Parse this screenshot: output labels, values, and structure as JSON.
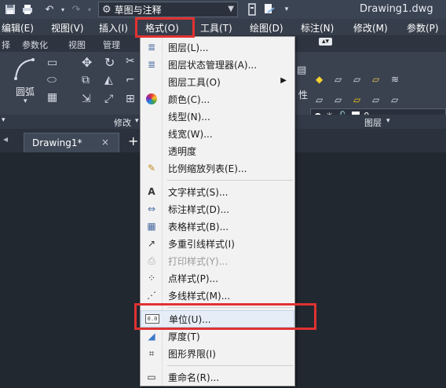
{
  "window": {
    "title": "Drawing1.dwg",
    "workspace": "草图与注释"
  },
  "menubar": {
    "items": [
      "编辑(E)",
      "视图(V)",
      "插入(I)",
      "格式(O)",
      "工具(T)",
      "绘图(D)",
      "标注(N)",
      "修改(M)",
      "参数(P)"
    ]
  },
  "ribbon": {
    "tabs": [
      "择",
      "参数化",
      "视图",
      "管理"
    ],
    "arc_label": "圆弧",
    "modify_label": "修改",
    "layers_label": "图层",
    "layer_current": "0",
    "attr_fragment": "性"
  },
  "doc_tabs": {
    "active": "Drawing1*",
    "close": "×",
    "new": "+"
  },
  "format_menu": {
    "items": [
      {
        "label": "图层(L)...",
        "icon": "layer-icon"
      },
      {
        "label": "图层状态管理器(A)...",
        "icon": "layer-state-icon"
      },
      {
        "label": "图层工具(O)",
        "icon": "none",
        "submenu": true
      },
      {
        "label": "颜色(C)...",
        "icon": "color-wheel-icon"
      },
      {
        "label": "线型(N)...",
        "icon": "none"
      },
      {
        "label": "线宽(W)...",
        "icon": "none"
      },
      {
        "label": "透明度",
        "icon": "none"
      },
      {
        "label": "比例缩放列表(E)...",
        "icon": "scale-list-icon"
      },
      {
        "label": "文字样式(S)...",
        "icon": "text-style-icon"
      },
      {
        "label": "标注样式(D)...",
        "icon": "dim-style-icon"
      },
      {
        "label": "表格样式(B)...",
        "icon": "table-style-icon"
      },
      {
        "label": "多重引线样式(I)",
        "icon": "mleader-style-icon"
      },
      {
        "label": "打印样式(Y)...",
        "icon": "plot-style-icon",
        "disabled": true
      },
      {
        "label": "点样式(P)...",
        "icon": "point-style-icon"
      },
      {
        "label": "多线样式(M)...",
        "icon": "mline-style-icon"
      },
      {
        "label": "单位(U)...",
        "icon": "units-icon",
        "highlighted": true
      },
      {
        "label": "厚度(T)",
        "icon": "thickness-icon"
      },
      {
        "label": "图形界限(I)",
        "icon": "limits-icon"
      },
      {
        "label": "重命名(R)...",
        "icon": "rename-icon"
      }
    ]
  },
  "colors": {
    "highlight_box": "#e03232",
    "menu_background": "#f2f2f2"
  }
}
